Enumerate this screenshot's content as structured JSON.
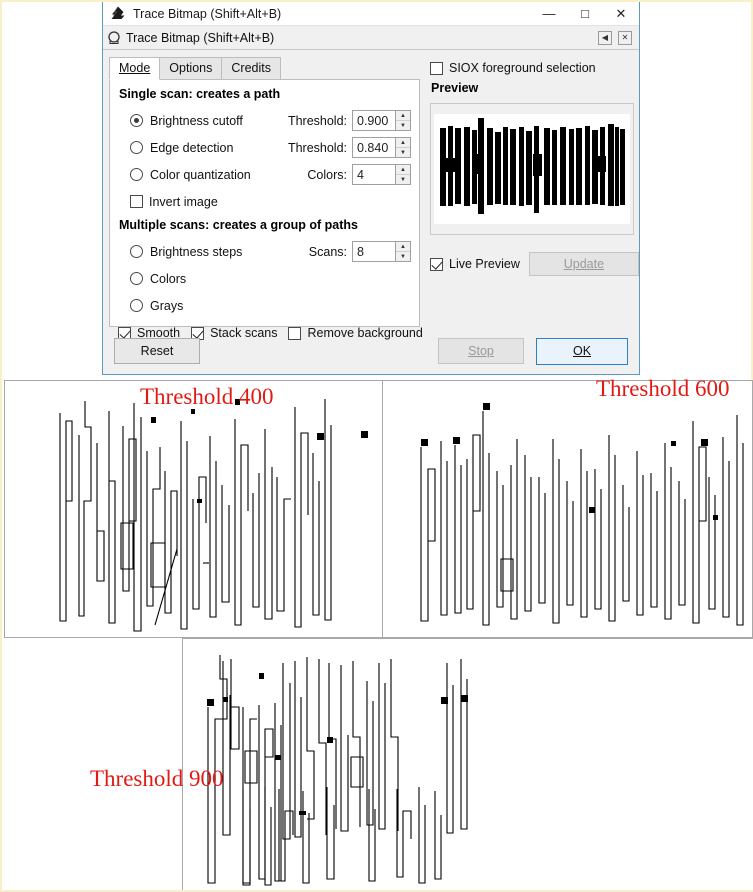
{
  "window": {
    "title": "Trace Bitmap (Shift+Alt+B)",
    "app_icon": "inkscape-icon",
    "controls": {
      "minimize": "—",
      "maximize": "□",
      "close": "✕"
    }
  },
  "inner_panel": {
    "title": "Trace Bitmap (Shift+Alt+B)",
    "dock_icon": "dock-icon",
    "buttons": {
      "undock": "◀",
      "close": "✕"
    }
  },
  "tabs": [
    {
      "label": "Mode",
      "accel": "M",
      "active": true
    },
    {
      "label": "Options",
      "accel": "O",
      "active": false
    },
    {
      "label": "Credits",
      "accel": "C",
      "active": false
    }
  ],
  "single_scan": {
    "heading": "Single scan: creates a path",
    "options": [
      {
        "label": "Brightness cutoff",
        "accel": "B",
        "selected": true,
        "field_label": "Threshold:",
        "field_accel": "T",
        "value": "0.900"
      },
      {
        "label": "Edge detection",
        "accel": "E",
        "selected": false,
        "field_label": "Threshold:",
        "field_accel": "h",
        "value": "0.840"
      },
      {
        "label": "Color quantization",
        "accel": "C",
        "selected": false,
        "field_label": "Colors:",
        "field_accel": "C",
        "value": "4"
      }
    ],
    "invert": {
      "label": "Invert image",
      "accel": "I",
      "checked": false
    }
  },
  "multiple_scans": {
    "heading": "Multiple scans: creates a group of paths",
    "options": [
      {
        "label": "Brightness steps",
        "accel": "r",
        "selected": false,
        "field_label": "Scans:",
        "field_accel": "a",
        "value": "8"
      },
      {
        "label": "Colors",
        "accel": "l",
        "selected": false
      },
      {
        "label": "Grays",
        "accel": "G",
        "selected": false
      }
    ],
    "flags": [
      {
        "label": "Smooth",
        "accel": "m",
        "checked": true
      },
      {
        "label": "Stack scans",
        "accel": "k",
        "checked": true
      },
      {
        "label": "Remove background",
        "accel": "v",
        "checked": false
      }
    ]
  },
  "right": {
    "siox": {
      "label": "SIOX foreground selection",
      "accel": "f",
      "checked": false
    },
    "preview_label": "Preview",
    "live_preview": {
      "label": "Live Preview",
      "checked": true
    },
    "update_button": {
      "label": "Update",
      "accel": "U",
      "enabled": false
    }
  },
  "footer": {
    "reset": {
      "label": "Reset",
      "enabled": true
    },
    "stop": {
      "label": "Stop",
      "accel": "S",
      "enabled": false
    },
    "ok": {
      "label": "OK",
      "accel": "O",
      "enabled": true,
      "focused": true
    }
  },
  "result_panels": [
    {
      "id": "panel-threshold-400",
      "caption": "Threshold 400"
    },
    {
      "id": "panel-threshold-600",
      "caption": "Threshold 600"
    },
    {
      "id": "panel-threshold-900",
      "caption": "Threshold 900"
    }
  ],
  "colors": {
    "caption_red": "#e01b15",
    "window_border": "#5b9bbd",
    "dialog_bg": "#f0f0f0",
    "focus_blue": "#2f7fc4",
    "page_border": "#faf0c8"
  }
}
